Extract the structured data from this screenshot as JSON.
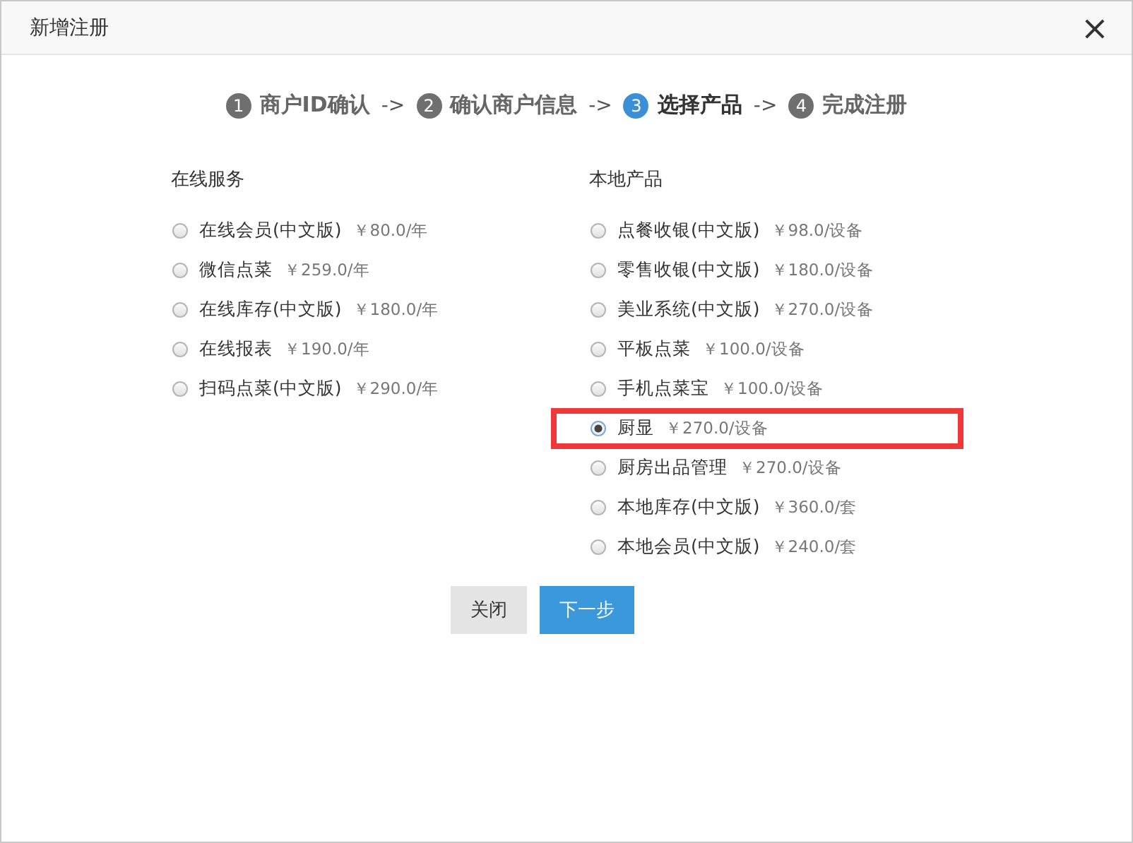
{
  "dialog": {
    "title": "新增注册",
    "close": "×"
  },
  "steps": [
    {
      "number": "1",
      "label": "商户ID确认",
      "selected": false,
      "arrow": "->"
    },
    {
      "number": "2",
      "label": "确认商户信息",
      "selected": false,
      "arrow": "->"
    },
    {
      "number": "3",
      "label": "选择产品",
      "selected": true,
      "arrow": "->"
    },
    {
      "number": "4",
      "label": "完成注册",
      "selected": false
    }
  ],
  "columns": [
    {
      "heading": "在线服务",
      "items": [
        {
          "name": "在线会员(中文版)",
          "price": "￥80.0/年",
          "selected": false,
          "highlighted": false
        },
        {
          "name": "微信点菜",
          "price": "￥259.0/年",
          "selected": false,
          "highlighted": false
        },
        {
          "name": "在线库存(中文版)",
          "price": "￥180.0/年",
          "selected": false,
          "highlighted": false
        },
        {
          "name": "在线报表",
          "price": "￥190.0/年",
          "selected": false,
          "highlighted": false
        },
        {
          "name": "扫码点菜(中文版)",
          "price": "￥290.0/年",
          "selected": false,
          "highlighted": false
        }
      ]
    },
    {
      "heading": "本地产品",
      "items": [
        {
          "name": "点餐收银(中文版)",
          "price": "￥98.0/设备",
          "selected": false,
          "highlighted": false
        },
        {
          "name": "零售收银(中文版)",
          "price": "￥180.0/设备",
          "selected": false,
          "highlighted": false
        },
        {
          "name": "美业系统(中文版)",
          "price": "￥270.0/设备",
          "selected": false,
          "highlighted": false
        },
        {
          "name": "平板点菜",
          "price": "￥100.0/设备",
          "selected": false,
          "highlighted": false
        },
        {
          "name": "手机点菜宝",
          "price": "￥100.0/设备",
          "selected": false,
          "highlighted": false
        },
        {
          "name": "厨显",
          "price": "￥270.0/设备",
          "selected": true,
          "highlighted": true
        },
        {
          "name": "厨房出品管理",
          "price": "￥270.0/设备",
          "selected": false,
          "highlighted": false
        },
        {
          "name": "本地库存(中文版)",
          "price": "￥360.0/套",
          "selected": false,
          "highlighted": false
        },
        {
          "name": "本地会员(中文版)",
          "price": "￥240.0/套",
          "selected": false,
          "highlighted": false
        }
      ]
    }
  ],
  "buttons": [
    {
      "label": "关闭",
      "kind": "secondary"
    },
    {
      "label": "下一步",
      "kind": "primary"
    }
  ]
}
